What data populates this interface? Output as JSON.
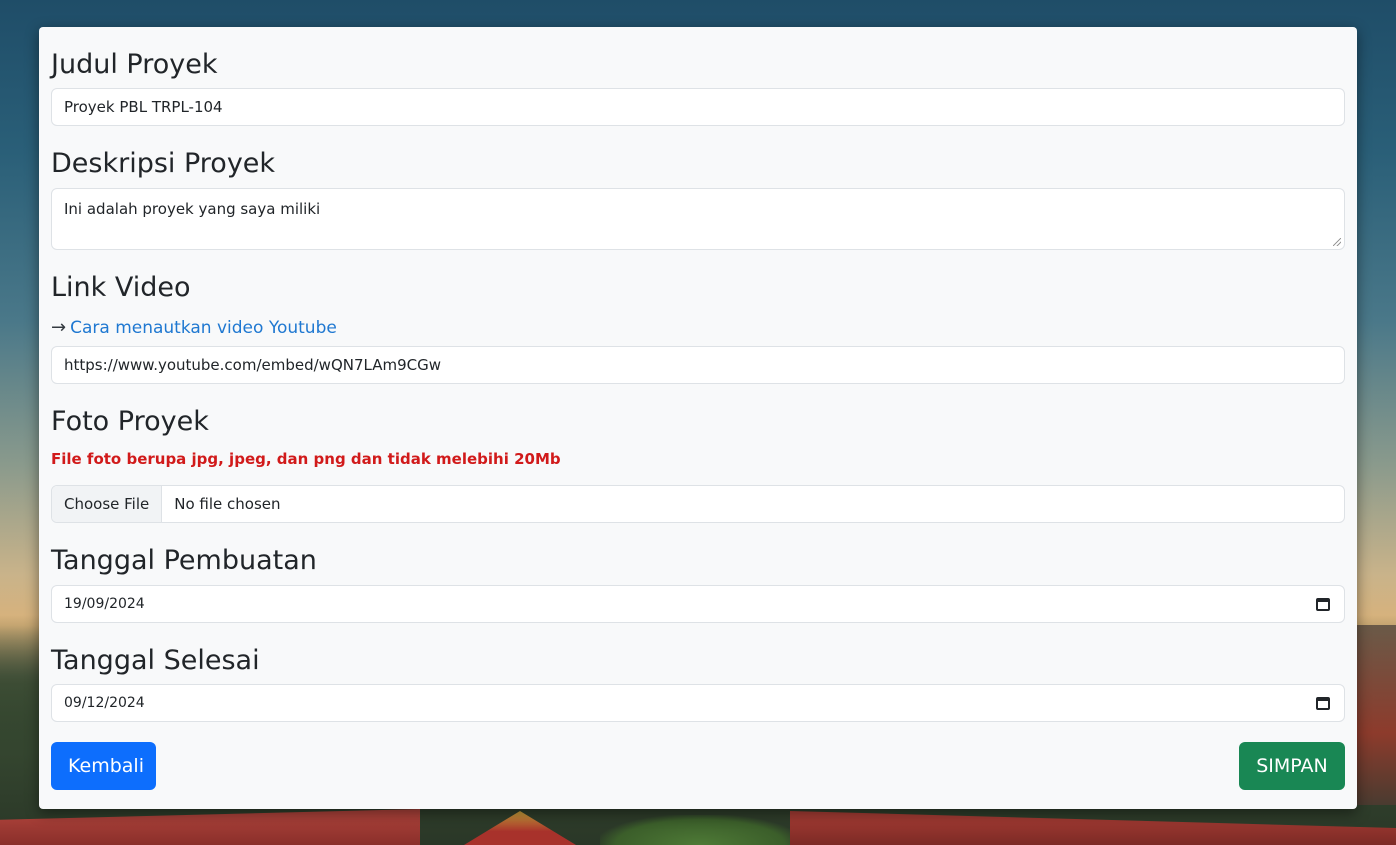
{
  "form": {
    "title_label": "Judul Proyek",
    "title_value": "Proyek PBL TRPL-104",
    "description_label": "Deskripsi Proyek",
    "description_value": "Ini adalah proyek yang saya miliki",
    "video_label": "Link Video",
    "video_help_arrow": "→",
    "video_help_link": "Cara menautkan video Youtube",
    "video_value": "https://www.youtube.com/embed/wQN7LAm9CGw",
    "photo_label": "Foto Proyek",
    "photo_warning": "File foto berupa jpg, jpeg, dan png dan tidak melebihi 20Mb",
    "photo_button": "Choose File",
    "photo_status": "No file chosen",
    "start_date_label": "Tanggal Pembuatan",
    "start_date_value": "19/09/2024",
    "end_date_label": "Tanggal Selesai",
    "end_date_value": "09/12/2024",
    "back_button": "Kembali",
    "save_button": "SIMPAN"
  },
  "colors": {
    "primary": "#0d6efd",
    "success": "#198754",
    "danger": "#d11a1a",
    "link": "#1f78d1"
  }
}
